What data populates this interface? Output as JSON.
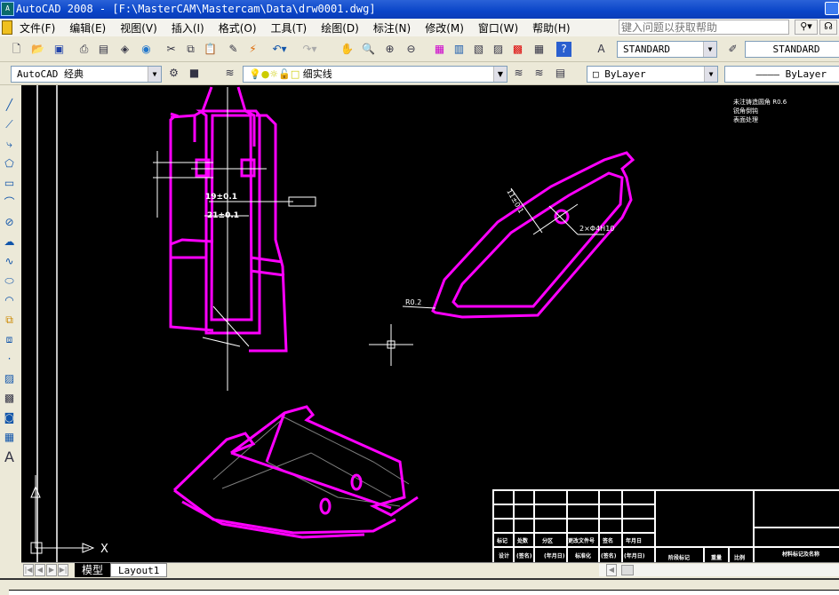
{
  "window": {
    "title": "AutoCAD 2008 - [F:\\MasterCAM\\Mastercam\\Data\\drw0001.dwg]",
    "app_icon": "autocad-icon"
  },
  "menu": [
    "文件(F)",
    "编辑(E)",
    "视图(V)",
    "插入(I)",
    "格式(O)",
    "工具(T)",
    "绘图(D)",
    "标注(N)",
    "修改(M)",
    "窗口(W)",
    "帮助(H)"
  ],
  "help_search": {
    "placeholder": "键入问题以获取帮助"
  },
  "toolbar": {
    "text_style": "STANDARD",
    "dim_style": "STANDARD",
    "workspace": "AutoCAD 经典",
    "layer": "细实线",
    "color": "ByLayer",
    "linetype": "ByLayer"
  },
  "drawing": {
    "colors": {
      "geometry": "#ff00ff",
      "annotation": "#ffffff",
      "hidden": "#808080",
      "background": "#000000"
    },
    "dimensions": [
      "19±0.1",
      "21±0.1",
      "11±0.1",
      "2×Φ4H10",
      "R0.2"
    ],
    "notes": [
      "未注铸造圆角 R0.6",
      "锐角倒钝",
      "表面处理"
    ],
    "title_block": {
      "row1": [
        "标记",
        "处数",
        "分区",
        "更改文件号",
        "签名",
        "年月日"
      ],
      "row2": [
        "设计",
        "(签名)",
        "(年月日)",
        "标准化",
        "(签名)",
        "(年月日)",
        "阶段标记",
        "重量",
        "比例",
        "材料标记及名称"
      ]
    },
    "ucs": {
      "x_label": "X"
    }
  },
  "tabs": {
    "model": "模型",
    "layout": "Layout1"
  }
}
